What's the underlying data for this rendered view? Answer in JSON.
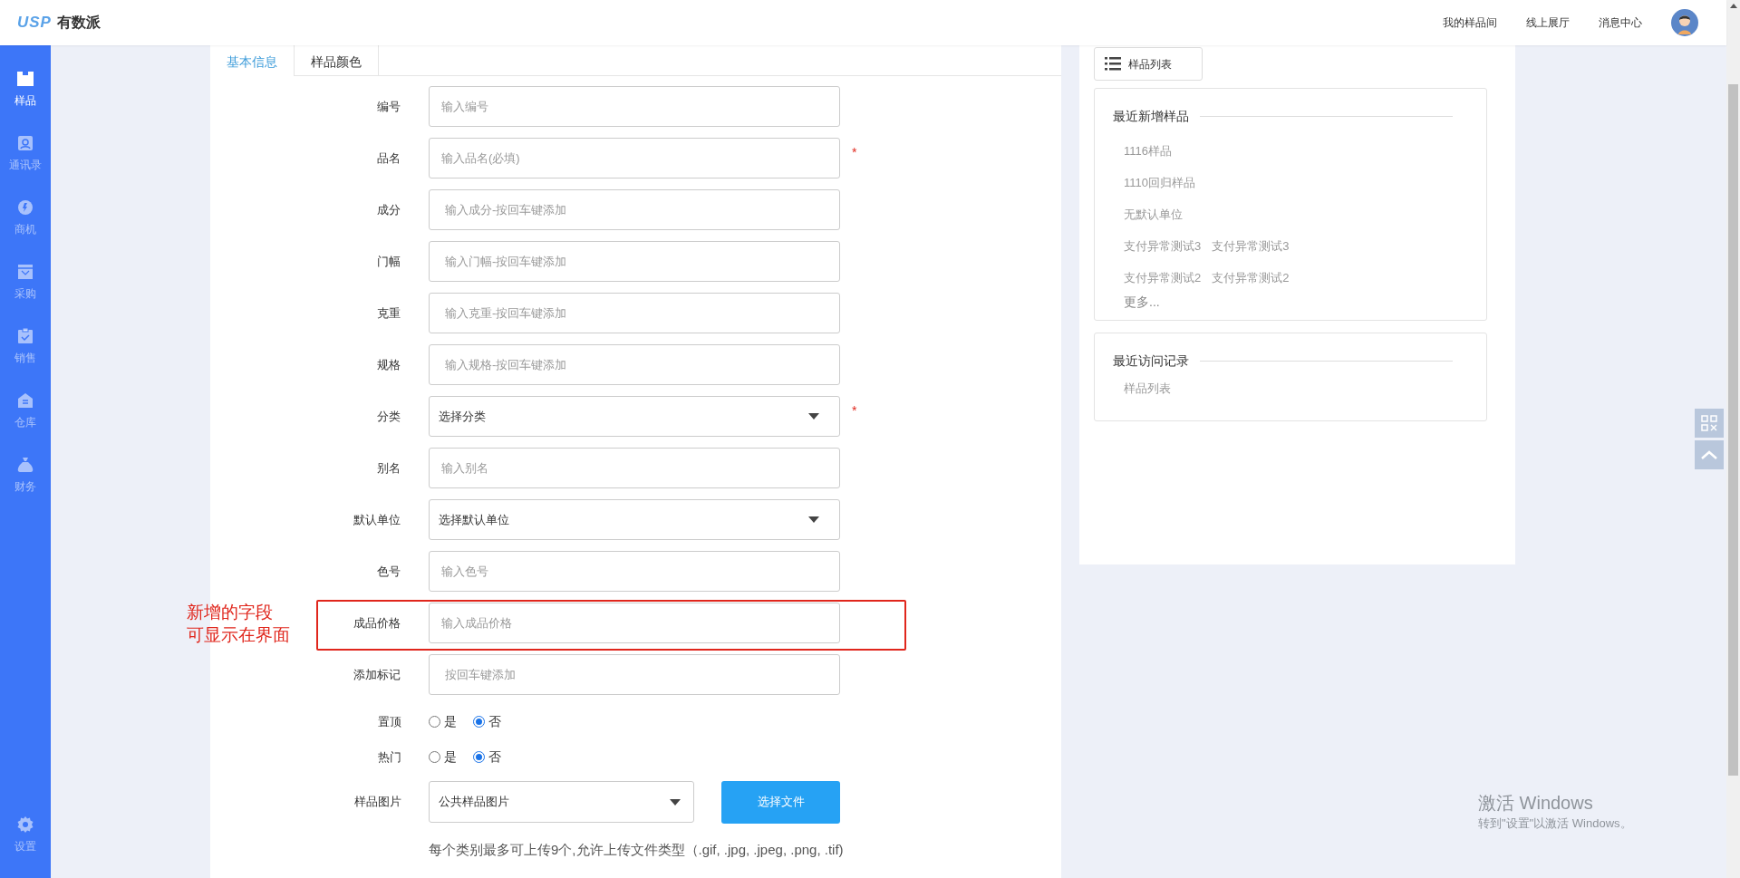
{
  "header": {
    "logo_mark": "USP",
    "logo_text": "有数派",
    "nav": [
      "我的样品间",
      "线上展厅",
      "消息中心"
    ]
  },
  "sidebar": {
    "items": [
      {
        "label": "样品",
        "selected": true
      },
      {
        "label": "通讯录",
        "selected": false
      },
      {
        "label": "商机",
        "selected": false
      },
      {
        "label": "采购",
        "selected": false
      },
      {
        "label": "销售",
        "selected": false
      },
      {
        "label": "仓库",
        "selected": false
      },
      {
        "label": "财务",
        "selected": false
      }
    ],
    "footer": {
      "label": "设置"
    }
  },
  "tabs": [
    {
      "label": "基本信息",
      "selected": true
    },
    {
      "label": "样品颜色",
      "selected": false
    }
  ],
  "form": {
    "required_mark": "*",
    "fields": [
      {
        "label": "编号",
        "kind": "input",
        "placeholder": "输入编号",
        "required": false,
        "highlighted": false
      },
      {
        "label": "品名",
        "kind": "input",
        "placeholder": "输入品名(必填)",
        "required": true,
        "highlighted": false
      },
      {
        "label": "成分",
        "kind": "tags",
        "placeholder": "输入成分-按回车键添加",
        "required": false,
        "highlighted": false
      },
      {
        "label": "门幅",
        "kind": "tags",
        "placeholder": "输入门幅-按回车键添加",
        "required": false,
        "highlighted": false
      },
      {
        "label": "克重",
        "kind": "tags",
        "placeholder": "输入克重-按回车键添加",
        "required": false,
        "highlighted": false
      },
      {
        "label": "规格",
        "kind": "tags",
        "placeholder": "输入规格-按回车键添加",
        "required": false,
        "highlighted": false
      },
      {
        "label": "分类",
        "kind": "select",
        "value": "选择分类",
        "required": true,
        "highlighted": false
      },
      {
        "label": "别名",
        "kind": "input",
        "placeholder": "输入别名",
        "required": false,
        "highlighted": false
      },
      {
        "label": "默认单位",
        "kind": "select",
        "value": "选择默认单位",
        "required": false,
        "highlighted": false
      },
      {
        "label": "色号",
        "kind": "input",
        "placeholder": "输入色号",
        "required": false,
        "highlighted": false
      },
      {
        "label": "成品价格",
        "kind": "input",
        "placeholder": "输入成品价格",
        "required": false,
        "highlighted": true
      },
      {
        "label": "添加标记",
        "kind": "tags",
        "placeholder": "按回车键添加",
        "required": false,
        "highlighted": false
      }
    ],
    "radios": [
      {
        "label": "置顶",
        "options": [
          {
            "label": "是",
            "selected": false
          },
          {
            "label": "否",
            "selected": true
          }
        ]
      },
      {
        "label": "热门",
        "options": [
          {
            "label": "是",
            "selected": false
          },
          {
            "label": "否",
            "selected": true
          }
        ]
      }
    ],
    "image": {
      "label": "样品图片",
      "value": "公共样品图片",
      "button": "选择文件"
    },
    "note": "每个类别最多可上传9个,允许上传文件类型（.gif, .jpg, .jpeg, .png, .tif)"
  },
  "annotation": {
    "lines": [
      "新增的字段",
      "可显示在界面"
    ]
  },
  "side_panel": {
    "list_button": "样品列表",
    "recent_added": {
      "title": "最近新增样品",
      "rows": [
        [
          "1116样品"
        ],
        [
          "1110回归样品"
        ],
        [
          "无默认单位"
        ],
        [
          "支付异常测试3",
          "支付异常测试3"
        ],
        [
          "支付异常测试2",
          "支付异常测试2"
        ]
      ],
      "more": "更多..."
    },
    "recent_visits": {
      "title": "最近访问记录",
      "items": [
        "样品列表"
      ]
    }
  },
  "os_notice": {
    "title": "激活 Windows",
    "subtitle": "转到\"设置\"以激活 Windows。"
  }
}
